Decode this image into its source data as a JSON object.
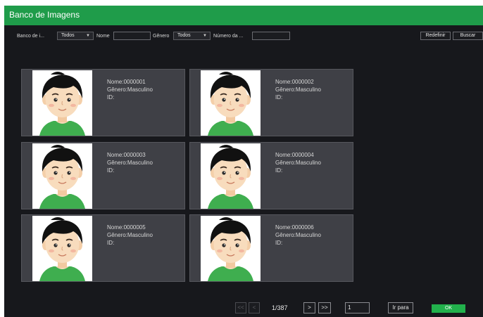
{
  "window": {
    "title": "Banco de Imagens"
  },
  "filters": {
    "database_label": "Banco de i...",
    "database_value": "Todos",
    "name_label": "Nome",
    "name_value": "",
    "gender_label": "Gênero",
    "gender_value": "Todos",
    "number_label": "Número da ...",
    "number_value": "",
    "reset_label": "Redefinir",
    "search_label": "Buscar"
  },
  "cards": [
    {
      "name": "Nome:0000001",
      "gender": "Gênero:Masculino",
      "id": "ID:"
    },
    {
      "name": "Nome:0000002",
      "gender": "Gênero:Masculino",
      "id": "ID:"
    },
    {
      "name": "Nome:0000003",
      "gender": "Gênero:Masculino",
      "id": "ID:"
    },
    {
      "name": "Nome:0000004",
      "gender": "Gênero:Masculino",
      "id": "ID:"
    },
    {
      "name": "Nome:0000005",
      "gender": "Gênero:Masculino",
      "id": "ID:"
    },
    {
      "name": "Nome:0000006",
      "gender": "Gênero:Masculino",
      "id": "ID:"
    }
  ],
  "pager": {
    "first": "<<",
    "prev": "<",
    "page_info": "1/387",
    "next": ">",
    "last": ">>",
    "page_input": "1",
    "goto_label": "Ir para",
    "ok_label": "OK"
  },
  "colors": {
    "accent": "#1f9c4a",
    "ok_button": "#22b14c",
    "background": "#17181c",
    "card": "#3f4046"
  },
  "icons": {
    "dropdown": "chevron-down-icon",
    "avatar": "person-avatar-icon"
  }
}
